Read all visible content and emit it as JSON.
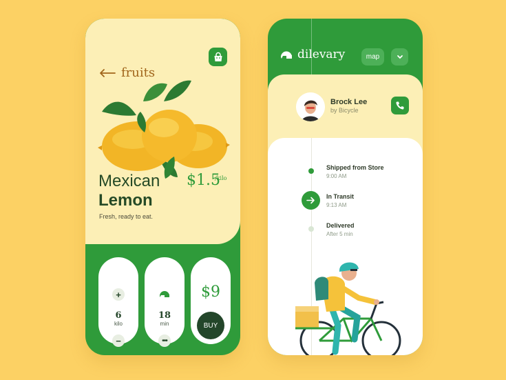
{
  "product_screen": {
    "header_title": "fruits",
    "product_name_line1": "Mexican",
    "product_name_line2": "Lemon",
    "price": "$1.5",
    "price_unit": "/kilo",
    "tagline": "Fresh, ready to eat.",
    "quantity": {
      "value": "6",
      "unit": "kilo"
    },
    "delivery": {
      "value": "18",
      "unit": "min"
    },
    "total": {
      "value": "$9",
      "button_label": "BUY"
    }
  },
  "delivery_screen": {
    "brand": "dilevary",
    "map_label": "map",
    "courier": {
      "name": "Brock Lee",
      "method": "by Bicycle"
    },
    "steps": [
      {
        "title": "Shipped from Store",
        "time": "9:00 AM",
        "state": "done"
      },
      {
        "title": "In Transit",
        "time": "9:13 AM",
        "state": "current"
      },
      {
        "title": "Delivered",
        "time": "After 5 min",
        "state": "pending"
      }
    ]
  },
  "colors": {
    "background": "#fcd164",
    "accent_green": "#2f9b3a",
    "cream": "#fcefb6",
    "dark_green": "#23462a",
    "price_brown": "#a0641a"
  },
  "icons": [
    "back-arrow-icon",
    "shopping-bag-icon",
    "plus-icon",
    "minus-icon",
    "helmet-icon",
    "more-icon",
    "brand-logo-icon",
    "chevron-down-icon",
    "phone-icon",
    "arrow-right-icon"
  ]
}
